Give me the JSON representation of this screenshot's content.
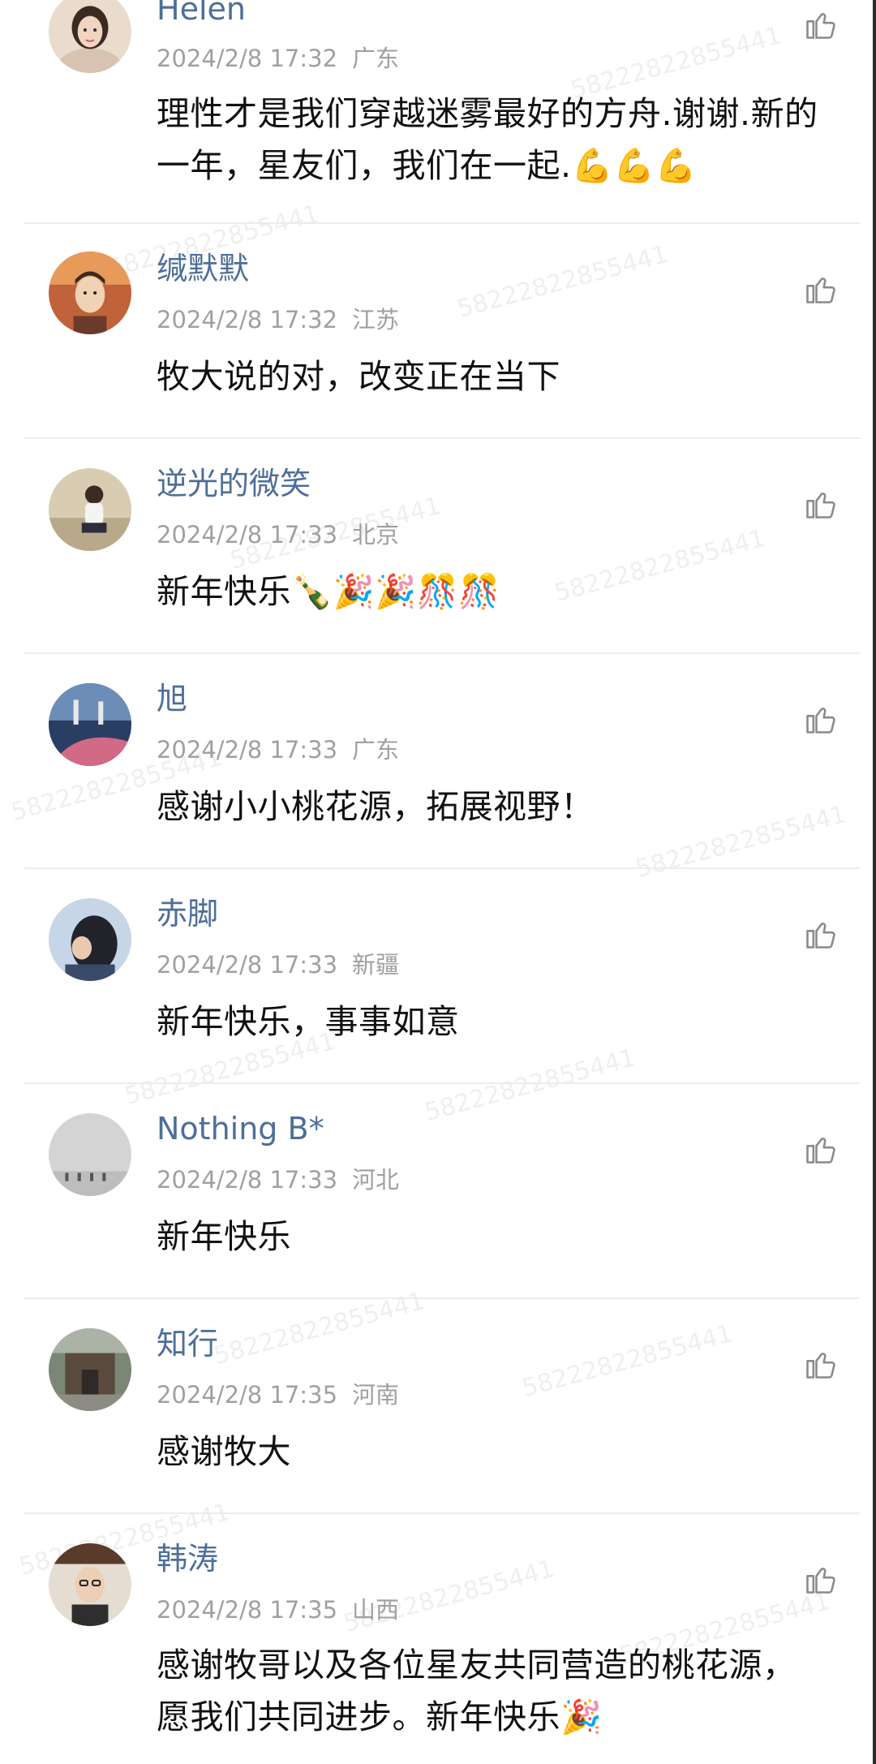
{
  "comments": [
    {
      "author": "Helen",
      "date": "2024/2/8 17:32",
      "location": "广东",
      "content": "理性才是我们穿越迷雾最好的方舟.谢谢.新的一年，星友们，我们在一起.💪💪💪",
      "avatar_icon": "woman-portrait-avatar",
      "avatar_color": "#d9b9a0"
    },
    {
      "author": "缄默默",
      "date": "2024/2/8 17:32",
      "location": "江苏",
      "content": "牧大说的对，改变正在当下",
      "avatar_icon": "man-portrait-avatar",
      "avatar_color": "#c96a3a"
    },
    {
      "author": "逆光的微笑",
      "date": "2024/2/8 17:33",
      "location": "北京",
      "content": "新年快乐🍾🎉🎉🎊🎊",
      "avatar_icon": "person-outdoor-avatar",
      "avatar_color": "#c8b89a"
    },
    {
      "author": "旭",
      "date": "2024/2/8 17:33",
      "location": "广东",
      "content": "感谢小小桃花源，拓展视野！",
      "avatar_icon": "playground-avatar",
      "avatar_color": "#5b7fa8"
    },
    {
      "author": "赤脚",
      "date": "2024/2/8 17:33",
      "location": "新疆",
      "content": "新年快乐，事事如意",
      "avatar_icon": "girl-profile-avatar",
      "avatar_color": "#8aa4c8"
    },
    {
      "author": "Nothing B*",
      "date": "2024/2/8 17:33",
      "location": "河北",
      "content": "新年快乐",
      "avatar_icon": "grey-landscape-avatar",
      "avatar_color": "#cfcfcf"
    },
    {
      "author": "知行",
      "date": "2024/2/8 17:35",
      "location": "河南",
      "content": "感谢牧大",
      "avatar_icon": "building-photo-avatar",
      "avatar_color": "#6f7a6a"
    },
    {
      "author": "韩涛",
      "date": "2024/2/8 17:35",
      "location": "山西",
      "content": "感谢牧哥以及各位星友共同营造的桃花源，愿我们共同进步。新年快乐🎉",
      "avatar_icon": "man-glasses-avatar",
      "avatar_color": "#b49a86"
    }
  ],
  "watermark_text": "58222822855441",
  "colors": {
    "author": "#4d6e98",
    "meta": "#a0a0a0",
    "content": "#111111",
    "divider": "#ececec"
  }
}
